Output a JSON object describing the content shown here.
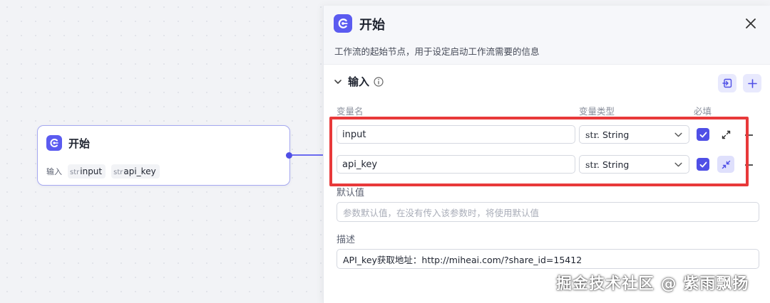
{
  "node": {
    "title": "开始",
    "inputs_label": "输入",
    "vars": [
      {
        "type": "str",
        "name": "input"
      },
      {
        "type": "str",
        "name": "api_key"
      }
    ]
  },
  "panel": {
    "title": "开始",
    "description": "工作流的起始节点，用于设定启动工作流需要的信息",
    "section_title": "输入",
    "columns": {
      "name": "变量名",
      "type": "变量类型",
      "required": "必填"
    },
    "rows": [
      {
        "name": "input",
        "type_prefix": "str.",
        "type_label": "String",
        "required": true,
        "expanded": false
      },
      {
        "name": "api_key",
        "type_prefix": "str.",
        "type_label": "String",
        "required": true,
        "expanded": true
      }
    ],
    "default_label": "默认值",
    "default_placeholder": "参数默认值，在没有传入该参数时，将使用默认值",
    "desc_label": "描述",
    "desc_value": "API_key获取地址：http://miheai.com/?share_id=15412"
  },
  "watermark": "掘金技术社区 @ 紫雨飘扬",
  "colors": {
    "accent": "#5b5bf0",
    "highlight": "#e8393a"
  },
  "icons": [
    "start-node-icon",
    "close-icon",
    "chevron-down-icon",
    "info-icon",
    "import-icon",
    "plus-icon",
    "check-icon",
    "expand-icon",
    "collapse-icon",
    "minus-icon"
  ]
}
